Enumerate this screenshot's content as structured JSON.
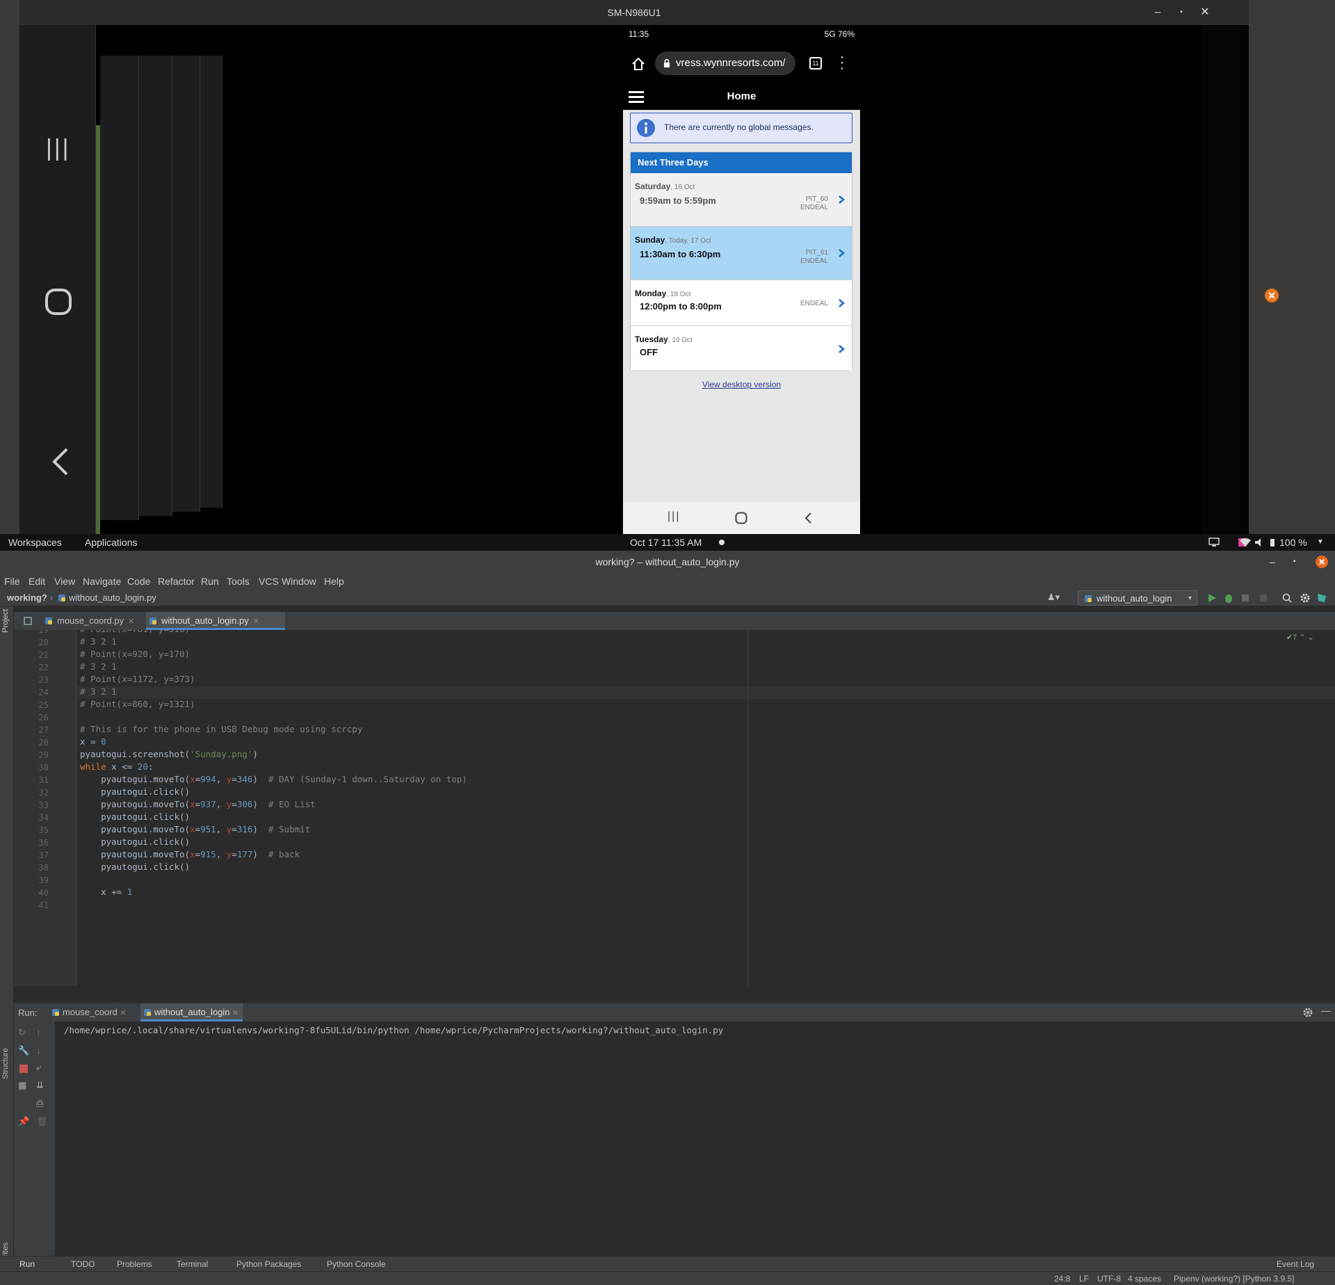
{
  "scrcpy": {
    "title": "SM-N986U1",
    "controls": [
      "–",
      "▪",
      "✕"
    ]
  },
  "phone": {
    "status": {
      "time": "11:35",
      "right": "5G 76%"
    },
    "url": "vress.wynnresorts.com/",
    "tab_count": "11",
    "nav_title": "Home",
    "global_message": "There are currently no global messages.",
    "days_header": "Next Three Days",
    "days": [
      {
        "name": "Saturday",
        "date": ", 16 Oct",
        "time": "9:59am to 5:59pm",
        "code1": "PIT_60",
        "code2": "ENDEAL"
      },
      {
        "name": "Sunday",
        "date": ", Today, 17 Oct",
        "time": "11:30am to 6:30pm",
        "code1": "PIT_61",
        "code2": "ENDEAL"
      },
      {
        "name": "Monday",
        "date": ", 18 Oct",
        "time": "12:00pm to 8:00pm",
        "code1": "",
        "code2": "ENDEAL"
      },
      {
        "name": "Tuesday",
        "date": ", 19 Oct",
        "time": "OFF",
        "code1": "",
        "code2": ""
      }
    ],
    "view_desktop": "View desktop version",
    "colors": {
      "header_blue": "#1a6fc6",
      "today_bg": "#a9d6f5",
      "saturday_bg": "#f0f0f0"
    }
  },
  "topbar": {
    "workspaces": "Workspaces",
    "applications": "Applications",
    "clock": "Oct 17  11:35 AM",
    "battery": "100 %"
  },
  "ide": {
    "title": "working? – without_auto_login.py",
    "menu": [
      "File",
      "Edit",
      "View",
      "Navigate",
      "Code",
      "Refactor",
      "Run",
      "Tools",
      "VCS",
      "Window",
      "Help"
    ],
    "breadcrumb": {
      "project": "working?",
      "file": "without_auto_login.py"
    },
    "run_config": "without_auto_login",
    "tabs": [
      "mouse_coord.py",
      "without_auto_login.py"
    ],
    "project_label": "Project",
    "inspection_count": "7",
    "code_lines": [
      {
        "n": "20",
        "t": "# 3 2 1"
      },
      {
        "n": "21",
        "t": "# Point(x=920, y=170)"
      },
      {
        "n": "22",
        "t": "# 3 2 1"
      },
      {
        "n": "23",
        "t": "# Point(x=1172, y=373)"
      },
      {
        "n": "24",
        "t": "# 3 2 1"
      },
      {
        "n": "25",
        "t": "# Point(x=860, y=1321)"
      },
      {
        "n": "26",
        "t": ""
      },
      {
        "n": "27",
        "t": "# This is for the phone in USB Debug mode using scrcpy"
      },
      {
        "n": "28",
        "t": "x = 0"
      },
      {
        "n": "29",
        "t": "pyautogui.screenshot('Sunday.png')"
      },
      {
        "n": "30",
        "t": "while x <= 20:"
      },
      {
        "n": "31",
        "t": "    pyautogui.moveTo(x=994, y=346)  # DAY (Sunday-1 down..Saturday on top)"
      },
      {
        "n": "32",
        "t": "    pyautogui.click()"
      },
      {
        "n": "33",
        "t": "    pyautogui.moveTo(x=937, y=306)  # EO List"
      },
      {
        "n": "34",
        "t": "    pyautogui.click()"
      },
      {
        "n": "35",
        "t": "    pyautogui.moveTo(x=951, y=316)  # Submit"
      },
      {
        "n": "36",
        "t": "    pyautogui.click()"
      },
      {
        "n": "37",
        "t": "    pyautogui.moveTo(x=915, y=177)  # back"
      },
      {
        "n": "38",
        "t": "    pyautogui.click()"
      },
      {
        "n": "39",
        "t": ""
      },
      {
        "n": "40",
        "t": "    x += 1"
      },
      {
        "n": "41",
        "t": ""
      }
    ],
    "run": {
      "label": "Run:",
      "tabs": [
        "mouse_coord",
        "without_auto_login"
      ],
      "output": "/home/wprice/.local/share/virtualenvs/working?-8fu5ULid/bin/python /home/wprice/PycharmProjects/working?/without_auto_login.py"
    },
    "side_labels": {
      "structure": "Structure",
      "favorites": "Favorites"
    },
    "bottom_tools": [
      "Run",
      "TODO",
      "Problems",
      "Terminal",
      "Python Packages",
      "Python Console"
    ],
    "event_log": "Event Log",
    "status": {
      "position": "24:8",
      "line_sep": "LF",
      "encoding": "UTF-8",
      "indent": "4 spaces",
      "interpreter": "Pipenv (working?) [Python 3.9.5]"
    }
  }
}
